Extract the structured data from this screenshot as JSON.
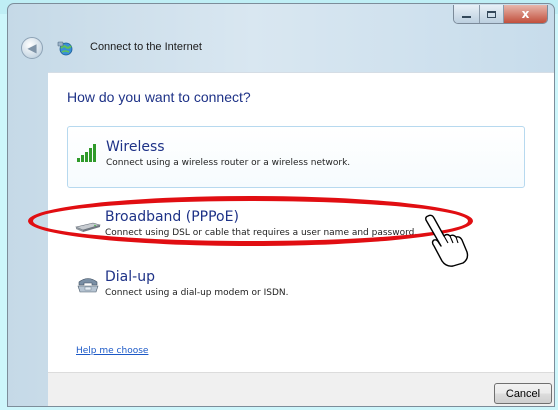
{
  "window": {
    "title": "Connect to the Internet",
    "controls": {
      "close_glyph": "x"
    }
  },
  "content": {
    "heading": "How do you want to connect?",
    "options": [
      {
        "title": "Wireless",
        "description": "Connect using a wireless router or a wireless network.",
        "icon": "wireless-signal-icon"
      },
      {
        "title": "Broadband (PPPoE)",
        "description": "Connect using DSL or cable that requires a user name and password.",
        "icon": "modem-icon"
      },
      {
        "title": "Dial-up",
        "description": "Connect using a dial-up modem or ISDN.",
        "icon": "telephone-icon"
      }
    ],
    "help_link": "Help me choose"
  },
  "footer": {
    "cancel_label": "Cancel"
  },
  "annotation": {
    "color": "#e10e12",
    "highlighted_option": "Broadband (PPPoE)"
  },
  "colors": {
    "heading": "#1e3287",
    "link": "#1c59c7",
    "hover_border": "#b7d9ef",
    "background": "#cdf6fb"
  }
}
